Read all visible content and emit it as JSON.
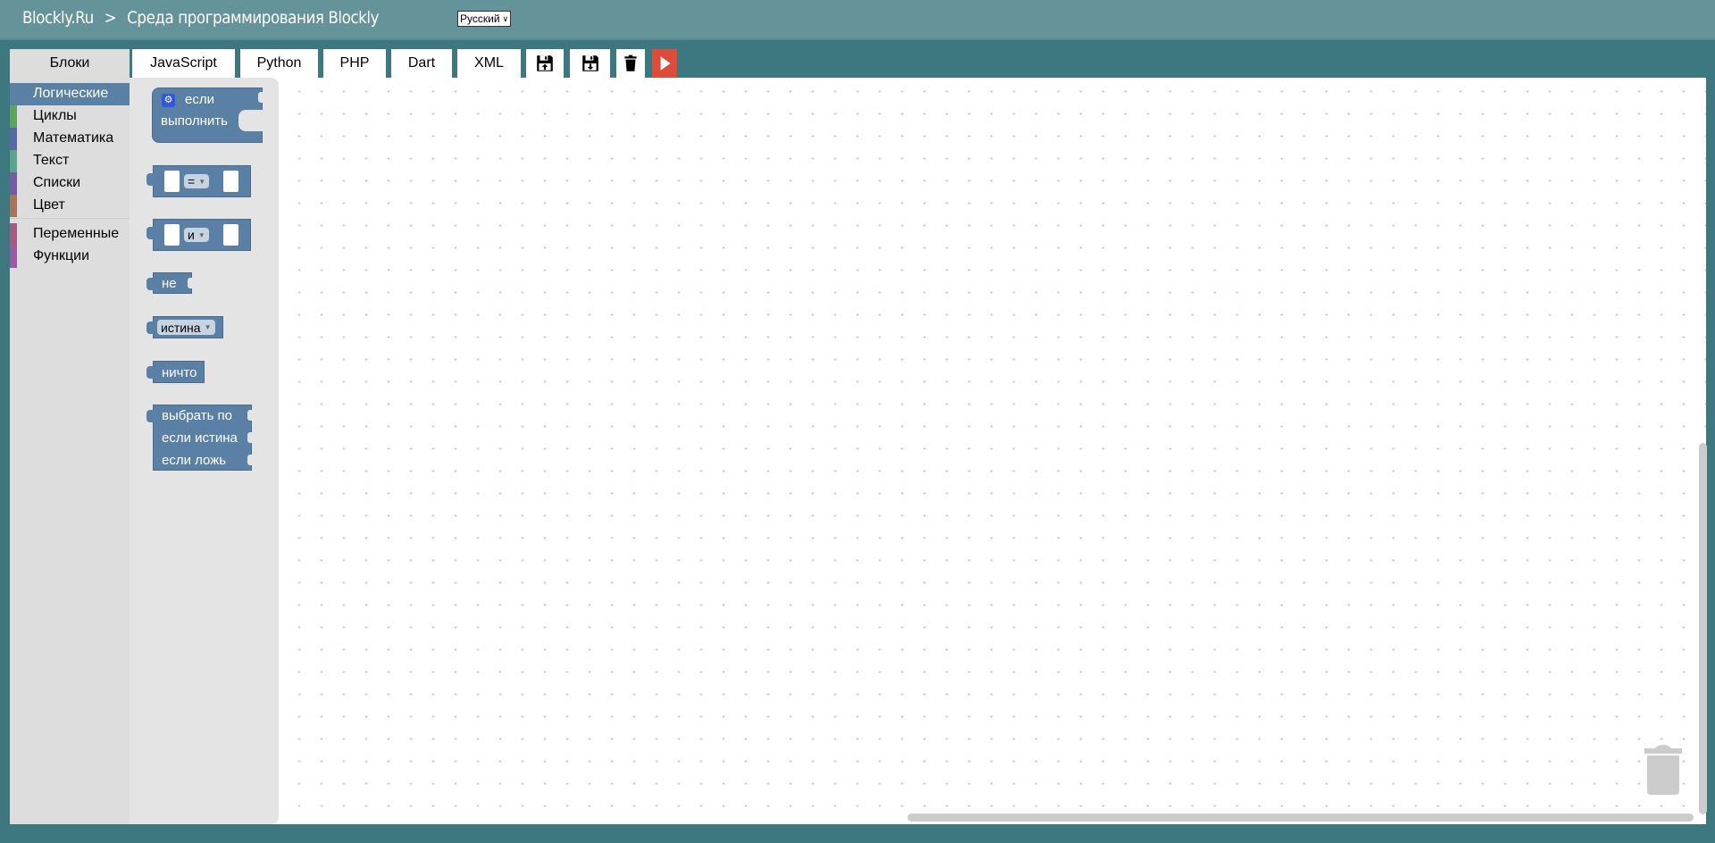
{
  "header": {
    "site": "Blockly.Ru",
    "separator": ">",
    "title": "Среда программирования Blockly",
    "language": "Русский"
  },
  "tabs": [
    {
      "label": "Блоки"
    },
    {
      "label": "JavaScript"
    },
    {
      "label": "Python"
    },
    {
      "label": "PHP"
    },
    {
      "label": "Dart"
    },
    {
      "label": "XML"
    }
  ],
  "toolbar": {
    "icons": [
      "save-upload-icon",
      "save-download-icon",
      "trash-icon",
      "run-icon"
    ]
  },
  "categories": [
    {
      "label": "Логические",
      "color": "#5b80a5"
    },
    {
      "label": "Циклы",
      "color": "#5ba55b"
    },
    {
      "label": "Математика",
      "color": "#5b67a5"
    },
    {
      "label": "Текст",
      "color": "#5ba58c"
    },
    {
      "label": "Списки",
      "color": "#745ba5"
    },
    {
      "label": "Цвет",
      "color": "#a5745b"
    },
    {
      "label": "Переменные",
      "color": "#a55b80"
    },
    {
      "label": "Функции",
      "color": "#995ba5"
    }
  ],
  "blocks": {
    "if_label": "если",
    "do_label": "выполнить",
    "compare_op": "=",
    "logic_op": "и",
    "not_label": "не",
    "bool_value": "истина",
    "null_label": "ничто",
    "ternary_test": "выбрать по",
    "ternary_then": "если истина",
    "ternary_else": "если ложь"
  }
}
